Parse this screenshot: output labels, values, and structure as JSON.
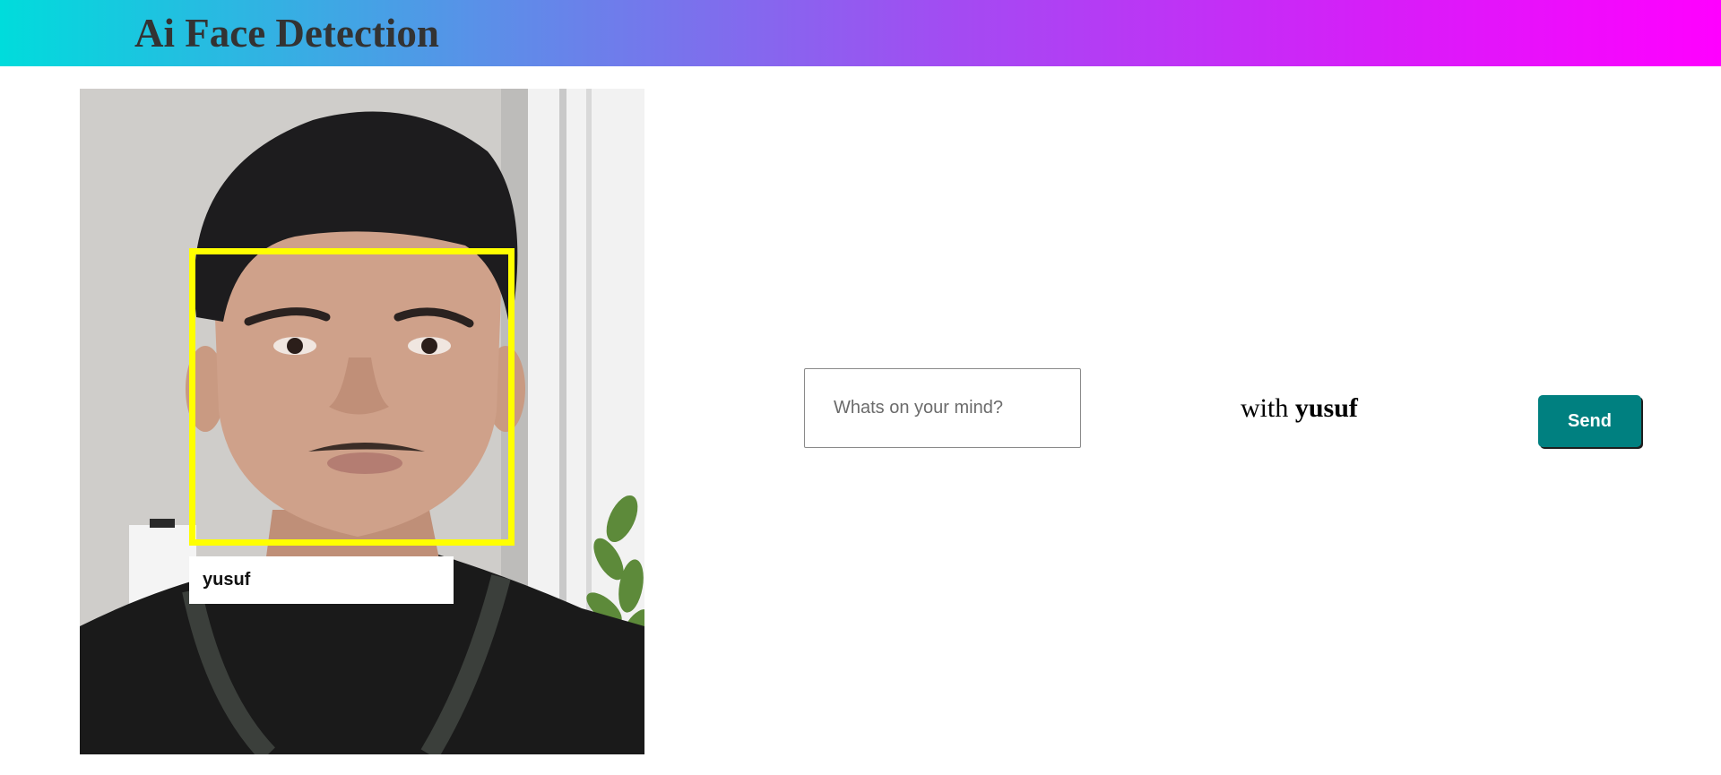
{
  "header": {
    "title": "Ai Face Detection"
  },
  "photo": {
    "detected_name": "yusuf",
    "box_color": "#ffff00"
  },
  "chat": {
    "input_placeholder": "Whats on your mind?",
    "input_value": "",
    "with_prefix": "with",
    "with_name": "yusuf",
    "send_label": "Send"
  },
  "colors": {
    "header_gradient_start": "#00dcdc",
    "header_gradient_end": "#ff00ff",
    "send_button_bg": "#008080"
  }
}
